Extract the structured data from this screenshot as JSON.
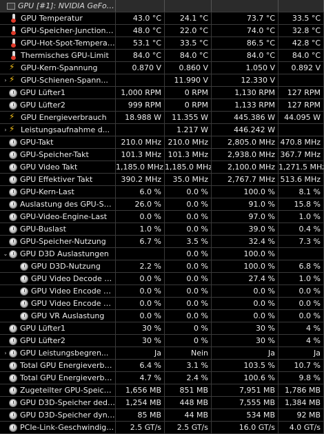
{
  "sensor_group": "GPU [#1]: NVIDIA GeFor...",
  "rows": [
    {
      "icon": "therm",
      "indent": 0,
      "expander": "",
      "label": "GPU Temperatur",
      "cur": "43.0 °C",
      "min": "24.1 °C",
      "max": "73.7 °C",
      "avg": "33.5 °C"
    },
    {
      "icon": "therm",
      "indent": 0,
      "expander": "",
      "label": "GPU-Speicher-Junction-T...",
      "cur": "48.0 °C",
      "min": "22.0 °C",
      "max": "74.0 °C",
      "avg": "32.8 °C"
    },
    {
      "icon": "therm",
      "indent": 0,
      "expander": "",
      "label": "GPU-Hot-Spot-Temperatur",
      "cur": "53.1 °C",
      "min": "33.5 °C",
      "max": "86.5 °C",
      "avg": "42.8 °C"
    },
    {
      "icon": "therm",
      "indent": 0,
      "expander": "",
      "label": "Thermisches GPU-Limit",
      "cur": "84.0 °C",
      "min": "84.0 °C",
      "max": "84.0 °C",
      "avg": "84.0 °C"
    },
    {
      "icon": "bolt",
      "indent": 0,
      "expander": "",
      "label": "GPU-Kern-Spannung",
      "cur": "0.870 V",
      "min": "0.860 V",
      "max": "1.050 V",
      "avg": "0.892 V"
    },
    {
      "icon": "bolt",
      "indent": 0,
      "expander": "›",
      "label": "GPU-Schienen-Spann...",
      "cur": "",
      "min": "11.990 V",
      "max": "12.330 V",
      "avg": ""
    },
    {
      "icon": "gauge",
      "indent": 0,
      "expander": "",
      "label": "GPU Lüfter1",
      "cur": "1,000 RPM",
      "min": "0 RPM",
      "max": "1,130 RPM",
      "avg": "127 RPM"
    },
    {
      "icon": "gauge",
      "indent": 0,
      "expander": "",
      "label": "GPU Lüfter2",
      "cur": "999 RPM",
      "min": "0 RPM",
      "max": "1,133 RPM",
      "avg": "127 RPM"
    },
    {
      "icon": "bolt",
      "indent": 0,
      "expander": "",
      "label": "GPU Energieverbrauch",
      "cur": "18.988 W",
      "min": "11.355 W",
      "max": "445.386 W",
      "avg": "44.095 W"
    },
    {
      "icon": "bolt",
      "indent": 0,
      "expander": "›",
      "label": "Leistungsaufnahme d...",
      "cur": "",
      "min": "1.217 W",
      "max": "446.242 W",
      "avg": ""
    },
    {
      "icon": "gauge",
      "indent": 0,
      "expander": "",
      "label": "GPU-Takt",
      "cur": "210.0 MHz",
      "min": "210.0 MHz",
      "max": "2,805.0 MHz",
      "avg": "470.8 MHz"
    },
    {
      "icon": "gauge",
      "indent": 0,
      "expander": "",
      "label": "GPU-Speicher-Takt",
      "cur": "101.3 MHz",
      "min": "101.3 MHz",
      "max": "2,938.0 MHz",
      "avg": "367.7 MHz"
    },
    {
      "icon": "gauge",
      "indent": 0,
      "expander": "",
      "label": "GPU Video Takt",
      "cur": "1,185.0 MHz",
      "min": "1,185.0 MHz",
      "max": "2,100.0 MHz",
      "avg": "1,271.5 MHz"
    },
    {
      "icon": "gauge",
      "indent": 0,
      "expander": "",
      "label": "GPU Effektiver Takt",
      "cur": "390.2 MHz",
      "min": "35.0 MHz",
      "max": "2,767.7 MHz",
      "avg": "513.6 MHz"
    },
    {
      "icon": "gauge",
      "indent": 0,
      "expander": "",
      "label": "GPU-Kern-Last",
      "cur": "6.0 %",
      "min": "0.0 %",
      "max": "100.0 %",
      "avg": "8.1 %"
    },
    {
      "icon": "gauge",
      "indent": 0,
      "expander": "",
      "label": "Auslastung des GPU-Spei...",
      "cur": "26.0 %",
      "min": "0.0 %",
      "max": "91.0 %",
      "avg": "15.8 %"
    },
    {
      "icon": "gauge",
      "indent": 0,
      "expander": "",
      "label": "GPU-Video-Engine-Last",
      "cur": "0.0 %",
      "min": "0.0 %",
      "max": "97.0 %",
      "avg": "1.0 %"
    },
    {
      "icon": "gauge",
      "indent": 0,
      "expander": "",
      "label": "GPU-Buslast",
      "cur": "1.0 %",
      "min": "0.0 %",
      "max": "39.0 %",
      "avg": "0.4 %"
    },
    {
      "icon": "gauge",
      "indent": 0,
      "expander": "",
      "label": "GPU-Speicher-Nutzung",
      "cur": "6.7 %",
      "min": "3.5 %",
      "max": "32.4 %",
      "avg": "7.3 %"
    },
    {
      "icon": "gauge",
      "indent": 0,
      "expander": "⌄",
      "label": "GPU D3D Auslastungen",
      "cur": "",
      "min": "0.0 %",
      "max": "100.0 %",
      "avg": ""
    },
    {
      "icon": "gauge",
      "indent": 1,
      "expander": "",
      "label": "GPU D3D-Nutzung",
      "cur": "2.2 %",
      "min": "0.0 %",
      "max": "100.0 %",
      "avg": "6.8 %"
    },
    {
      "icon": "gauge",
      "indent": 1,
      "expander": "",
      "label": "GPU Video Decode 0 ...",
      "cur": "0.0 %",
      "min": "0.0 %",
      "max": "27.4 %",
      "avg": "1.0 %"
    },
    {
      "icon": "gauge",
      "indent": 1,
      "expander": "",
      "label": "GPU Video Encode 0 ...",
      "cur": "0.0 %",
      "min": "0.0 %",
      "max": "0.0 %",
      "avg": "0.0 %"
    },
    {
      "icon": "gauge",
      "indent": 1,
      "expander": "",
      "label": "GPU Video Encode 1 ...",
      "cur": "0.0 %",
      "min": "0.0 %",
      "max": "0.0 %",
      "avg": "0.0 %"
    },
    {
      "icon": "gauge",
      "indent": 1,
      "expander": "",
      "label": "GPU VR Auslastung",
      "cur": "0.0 %",
      "min": "0.0 %",
      "max": "0.0 %",
      "avg": "0.0 %"
    },
    {
      "icon": "gauge",
      "indent": 0,
      "expander": "",
      "label": "GPU Lüfter1",
      "cur": "30 %",
      "min": "0 %",
      "max": "30 %",
      "avg": "4 %"
    },
    {
      "icon": "gauge",
      "indent": 0,
      "expander": "",
      "label": "GPU Lüfter2",
      "cur": "30 %",
      "min": "0 %",
      "max": "30 %",
      "avg": "4 %"
    },
    {
      "icon": "gauge",
      "indent": 0,
      "expander": "›",
      "label": "GPU Leistungsbegren...",
      "cur": "Ja",
      "min": "Nein",
      "max": "Ja",
      "avg": "Ja"
    },
    {
      "icon": "gauge",
      "indent": 0,
      "expander": "",
      "label": "Total GPU Energieverbra...",
      "cur": "6.4 %",
      "min": "3.1 %",
      "max": "103.5 %",
      "avg": "10.7 %"
    },
    {
      "icon": "gauge",
      "indent": 0,
      "expander": "",
      "label": "Total GPU Energieverbra...",
      "cur": "4.7 %",
      "min": "2.4 %",
      "max": "100.6 %",
      "avg": "9.8 %"
    },
    {
      "icon": "gauge",
      "indent": 0,
      "expander": "",
      "label": "Zugeteilter GPU-Speicher",
      "cur": "1,656 MB",
      "min": "851 MB",
      "max": "7,951 MB",
      "avg": "1,786 MB"
    },
    {
      "icon": "gauge",
      "indent": 0,
      "expander": "",
      "label": "GPU D3D-Speicher dedizi...",
      "cur": "1,254 MB",
      "min": "448 MB",
      "max": "7,555 MB",
      "avg": "1,384 MB"
    },
    {
      "icon": "gauge",
      "indent": 0,
      "expander": "",
      "label": "GPU D3D-Speicher dyna...",
      "cur": "85 MB",
      "min": "44 MB",
      "max": "534 MB",
      "avg": "92 MB"
    },
    {
      "icon": "gauge",
      "indent": 0,
      "expander": "",
      "label": "PCIe-Link-Geschwindigkeit",
      "cur": "2.5 GT/s",
      "min": "2.5 GT/s",
      "max": "16.0 GT/s",
      "avg": "4.0 GT/s"
    }
  ]
}
